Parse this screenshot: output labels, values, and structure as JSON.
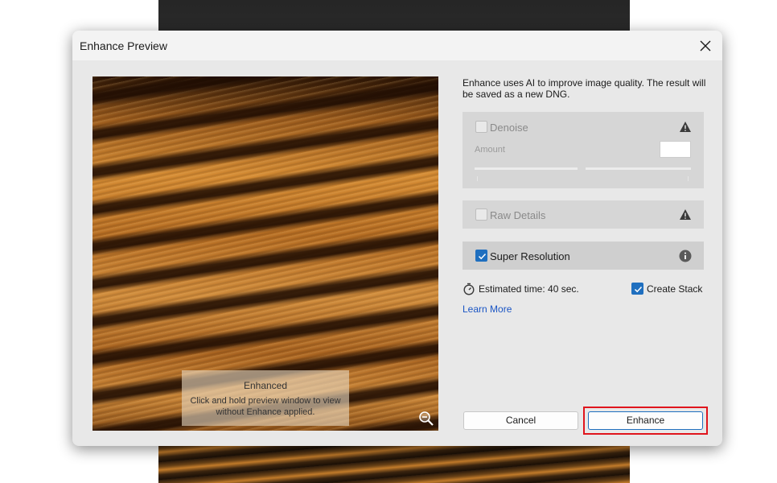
{
  "dialog": {
    "title": "Enhance Preview"
  },
  "preview": {
    "overlay_title": "Enhanced",
    "overlay_line1": "Click and hold preview window to view",
    "overlay_line2": "without Enhance applied."
  },
  "panel": {
    "description": "Enhance uses AI to improve image quality. The result will be saved as a new DNG.",
    "denoise": {
      "label": "Denoise",
      "checked": false,
      "amount_label": "Amount",
      "amount_value": ""
    },
    "raw_details": {
      "label": "Raw Details",
      "checked": false
    },
    "super_resolution": {
      "label": "Super Resolution",
      "checked": true
    },
    "estimated_time": "Estimated time: 40 sec.",
    "create_stack": {
      "label": "Create Stack",
      "checked": true
    },
    "learn_more": "Learn More"
  },
  "buttons": {
    "cancel": "Cancel",
    "enhance": "Enhance"
  },
  "colors": {
    "accent": "#1f6fbf",
    "highlight": "#e0151d",
    "link": "#1a55c4"
  }
}
